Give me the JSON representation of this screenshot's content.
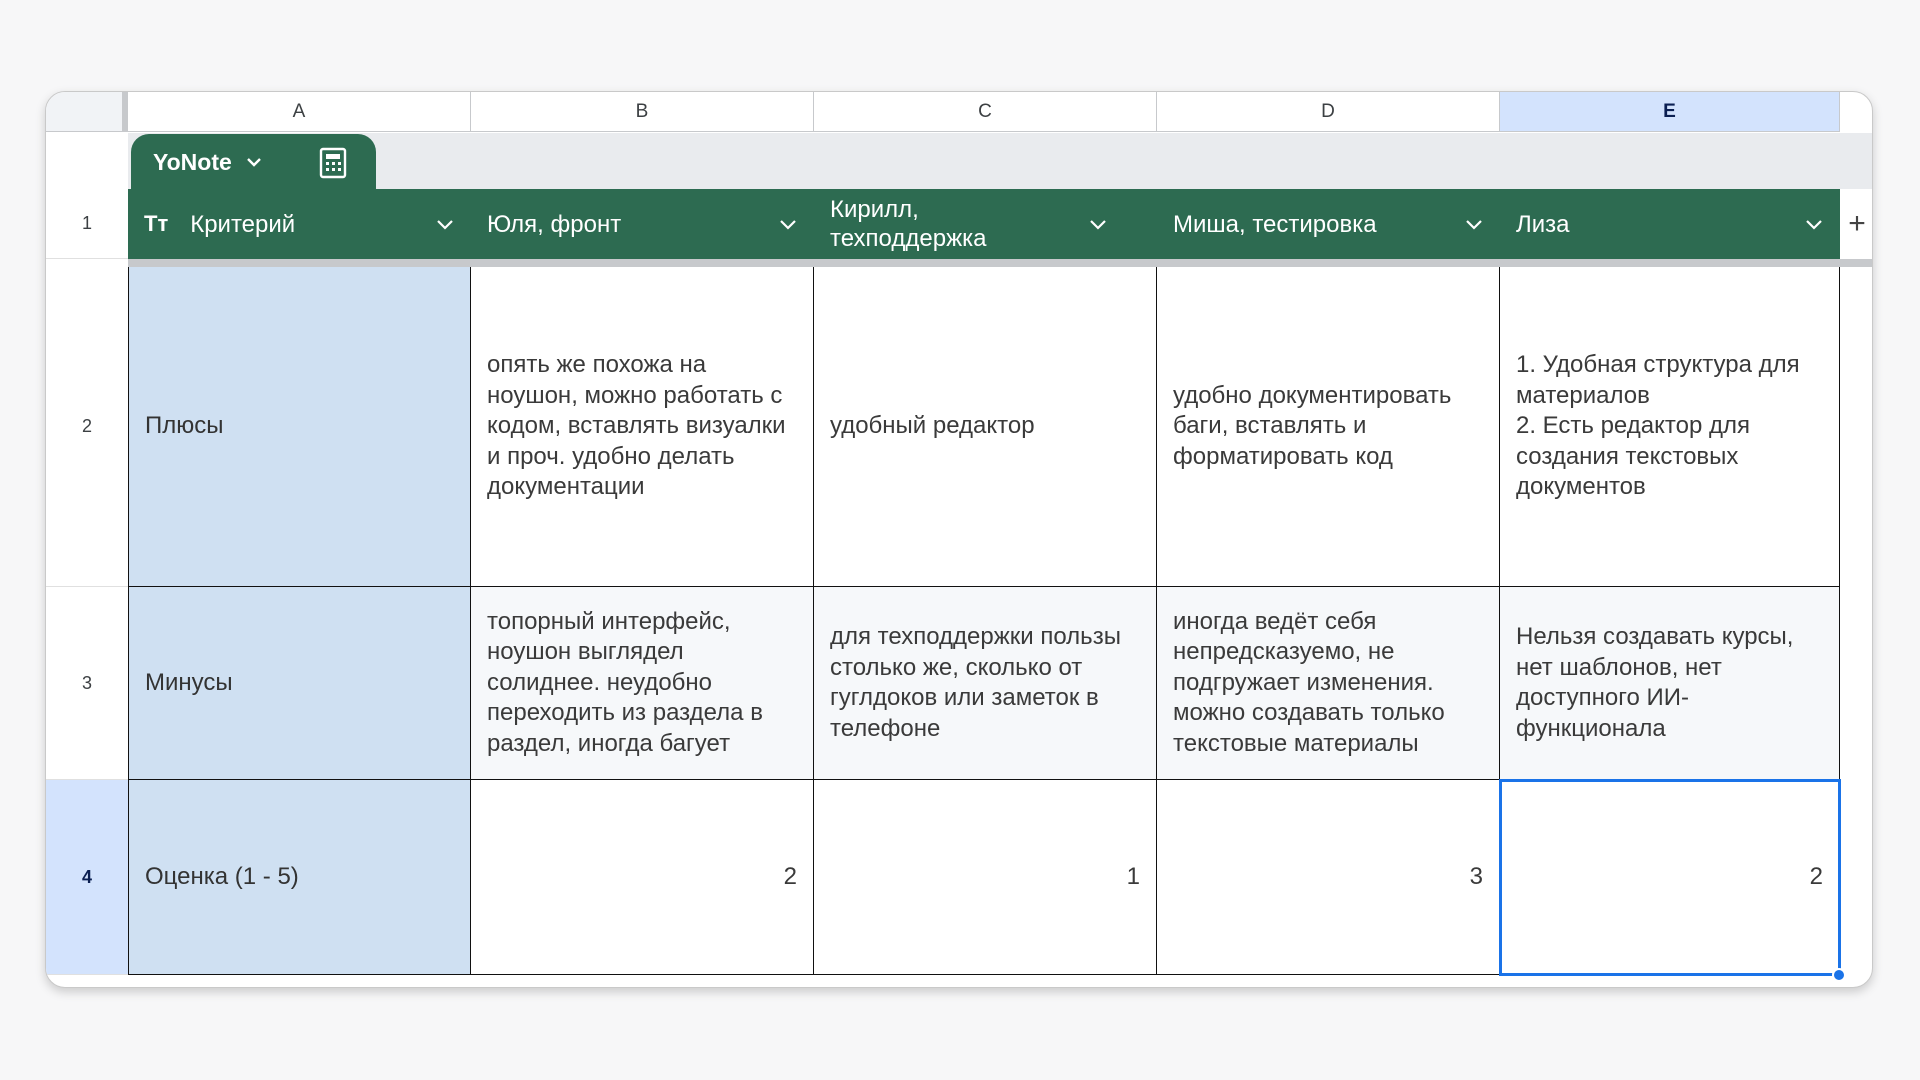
{
  "columns": [
    "A",
    "B",
    "C",
    "D",
    "E"
  ],
  "rows": [
    "1",
    "2",
    "3",
    "4"
  ],
  "tab": {
    "name": "YoNote",
    "dropdown_icon": "chevron-down-icon",
    "calc_icon": "calculator-icon"
  },
  "table_header": {
    "type_icon": "Тт",
    "cells": [
      "Критерий",
      "Юля, фронт",
      "Кирилл, техподдержка",
      "Миша, тестировка",
      "Лиза"
    ]
  },
  "table_rows": [
    {
      "criterion": "Плюсы",
      "values": [
        "опять же похожа на ноушон, можно работать с кодом, вставлять визуалки и проч. удобно делать документации",
        "удобный редактор",
        "удобно документировать баги, вставлять и форматировать код",
        "1. Удобная структура для материалов\n2. Есть редактор для создания текстовых документов"
      ]
    },
    {
      "criterion": "Минусы",
      "values": [
        "топорный интерфейс, ноушон выглядел солиднее. неудобно переходить из раздела в раздел, иногда багует",
        "для техподдержки пользы столько же, сколько от гуглдоков или заметок в телефоне",
        "иногда ведёт себя непредсказуемо, не подгружает изменения. можно создавать только текстовые материалы",
        "Нельзя создавать курсы, нет шаблонов, нет доступного ИИ-функционала"
      ]
    },
    {
      "criterion": "Оценка (1 - 5)",
      "values": [
        "2",
        "1",
        "3",
        "2"
      ]
    }
  ],
  "add_column_label": "+",
  "selection": {
    "column": "E",
    "row": "4"
  },
  "colors": {
    "header_green": "#2d6b51",
    "criterion_fill": "#cfe0f2",
    "selection_blue": "#1a73e8"
  }
}
